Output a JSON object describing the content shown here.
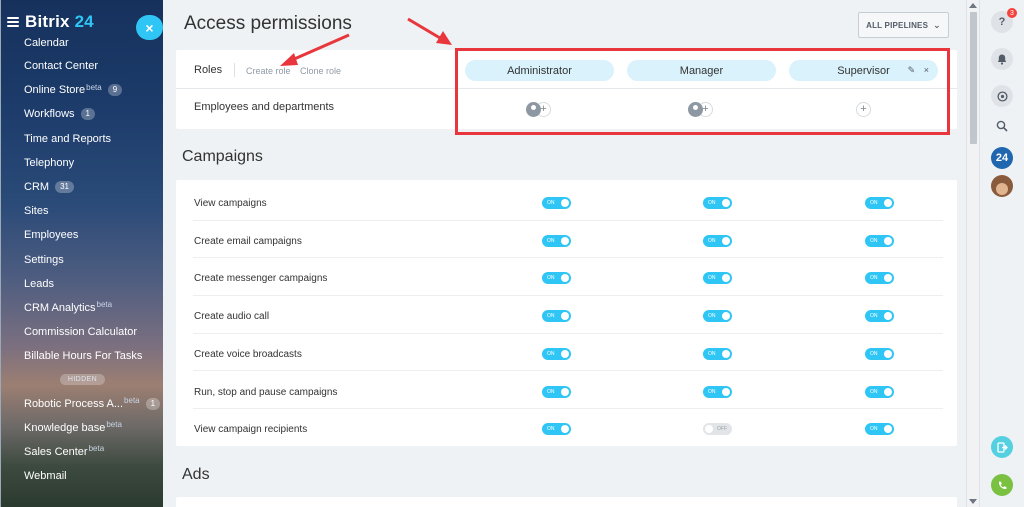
{
  "sidebar": {
    "brand": "Bitrix",
    "brand_number": "24",
    "collapse_label": "×",
    "items": [
      {
        "label": "Calendar"
      },
      {
        "label": "Contact Center"
      },
      {
        "label": "Online Store",
        "beta": "beta",
        "count": "9"
      },
      {
        "label": "Workflows",
        "count": "1"
      },
      {
        "label": "Time and Reports"
      },
      {
        "label": "Telephony"
      },
      {
        "label": "CRM",
        "count": "31"
      },
      {
        "label": "Sites"
      },
      {
        "label": "Employees"
      },
      {
        "label": "Settings"
      },
      {
        "label": "Leads"
      },
      {
        "label": "CRM Analytics",
        "beta": "beta"
      },
      {
        "label": "Commission Calculator"
      },
      {
        "label": "Billable Hours For Tasks"
      }
    ],
    "hidden_label": "HIDDEN",
    "items_after": [
      {
        "label": "Robotic Process A...",
        "beta": "beta",
        "count": "1"
      },
      {
        "label": "Knowledge base",
        "beta": "beta"
      },
      {
        "label": "Sales Center",
        "beta": "beta"
      },
      {
        "label": "Webmail"
      }
    ]
  },
  "header": {
    "title": "Access permissions",
    "pipelines_button": "ALL PIPELINES",
    "pipelines_chevron": "⌄"
  },
  "roles": {
    "label": "Roles",
    "create_role": "Create role",
    "clone_role": "Clone role",
    "columns": [
      "Administrator",
      "Manager",
      "Supervisor"
    ],
    "edit_icon": "✎",
    "close_icon": "×",
    "employees_label": "Employees and departments",
    "plus": "+"
  },
  "sections": {
    "campaigns": "Campaigns",
    "ads": "Ads"
  },
  "permissions": [
    {
      "label": "View campaigns",
      "values": [
        "on",
        "on",
        "on"
      ]
    },
    {
      "label": "Create email campaigns",
      "values": [
        "on",
        "on",
        "on"
      ]
    },
    {
      "label": "Create messenger campaigns",
      "values": [
        "on",
        "on",
        "on"
      ]
    },
    {
      "label": "Create audio call",
      "values": [
        "on",
        "on",
        "on"
      ]
    },
    {
      "label": "Create voice broadcasts",
      "values": [
        "on",
        "on",
        "on"
      ]
    },
    {
      "label": "Run, stop and pause campaigns",
      "values": [
        "on",
        "on",
        "on"
      ]
    },
    {
      "label": "View campaign recipients",
      "values": [
        "on",
        "off",
        "on"
      ]
    }
  ],
  "toggle_text": {
    "on": "ON",
    "off": "OFF"
  },
  "right_panel": {
    "help": "?",
    "help_badge": "3",
    "bell": "🔔",
    "chat": "◎",
    "search": "🔍",
    "b24": "24",
    "open": "⇥",
    "phone": "✆"
  },
  "colors": {
    "accent": "#2fc6f6",
    "pill": "#d9f2fb",
    "annotation": "#e8363c"
  }
}
